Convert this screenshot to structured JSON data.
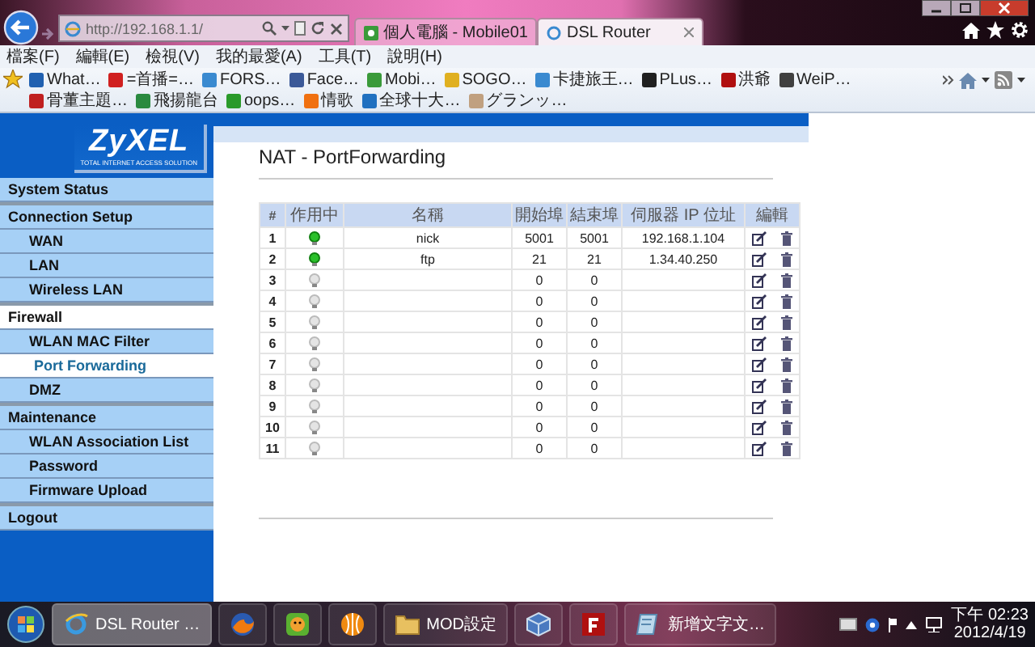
{
  "browser": {
    "address": "http://192.168.1.1/",
    "tabs": [
      {
        "label": "個人電腦 - Mobile01",
        "selected": false
      },
      {
        "label": "DSL Router",
        "selected": true
      }
    ],
    "menu": [
      "檔案(F)",
      "編輯(E)",
      "檢視(V)",
      "我的最愛(A)",
      "工具(T)",
      "說明(H)"
    ],
    "favorites": [
      {
        "label": "What…",
        "color": "#2060b0"
      },
      {
        "label": "=首播=…",
        "color": "#d02020"
      },
      {
        "label": "FORS…",
        "color": "#3a8ad0"
      },
      {
        "label": "Face…",
        "color": "#3b5998"
      },
      {
        "label": "Mobi…",
        "color": "#3a9a3a"
      },
      {
        "label": "SOGO…",
        "color": "#e0b020"
      },
      {
        "label": "卡捷旅王…",
        "color": "#3a8ad0"
      },
      {
        "label": "PLus…",
        "color": "#202020"
      },
      {
        "label": "洪爺",
        "color": "#b01010"
      },
      {
        "label": "WeiP…",
        "color": "#404040"
      },
      {
        "label": "骨董主題…",
        "color": "#c02020"
      },
      {
        "label": "飛揚龍台",
        "color": "#2a8a40"
      },
      {
        "label": "oops…",
        "color": "#2a9a2a"
      },
      {
        "label": "情歌",
        "color": "#f07010"
      },
      {
        "label": "全球十大…",
        "color": "#2070c0"
      },
      {
        "label": "グランッ…",
        "color": "#c0a080"
      }
    ]
  },
  "sidebar": {
    "logo": "ZyXEL",
    "tagline": "TOTAL INTERNET ACCESS SOLUTION",
    "items": [
      {
        "label": "System Status",
        "selected": false
      },
      {
        "label": "Connection Setup",
        "selected": false,
        "children": [
          {
            "label": "WAN",
            "selected": false
          },
          {
            "label": "LAN",
            "selected": false
          },
          {
            "label": "Wireless LAN",
            "selected": false
          }
        ]
      },
      {
        "label": "Firewall",
        "selected": true,
        "children": [
          {
            "label": "WLAN MAC Filter",
            "selected": false
          },
          {
            "label": "Port Forwarding",
            "selected": true
          },
          {
            "label": "DMZ",
            "selected": false
          }
        ]
      },
      {
        "label": "Maintenance",
        "selected": false,
        "children": [
          {
            "label": "WLAN Association List",
            "selected": false
          },
          {
            "label": "Password",
            "selected": false
          },
          {
            "label": "Firmware Upload",
            "selected": false
          }
        ]
      },
      {
        "label": "Logout",
        "selected": false
      }
    ]
  },
  "page": {
    "title": "NAT - PortForwarding",
    "table": {
      "columns": [
        "#",
        "作用中",
        "名稱",
        "開始埠",
        "結束埠",
        "伺服器 IP 位址",
        "編輯"
      ],
      "rows": [
        {
          "index": "1",
          "active": true,
          "name": "nick",
          "start": "5001",
          "end": "5001",
          "ip": "192.168.1.104"
        },
        {
          "index": "2",
          "active": true,
          "name": "ftp",
          "start": "21",
          "end": "21",
          "ip": "1.34.40.250"
        },
        {
          "index": "3",
          "active": false,
          "start": "0",
          "end": "0"
        },
        {
          "index": "4",
          "active": false,
          "start": "0",
          "end": "0"
        },
        {
          "index": "5",
          "active": false,
          "start": "0",
          "end": "0"
        },
        {
          "index": "6",
          "active": false,
          "start": "0",
          "end": "0"
        },
        {
          "index": "7",
          "active": false,
          "start": "0",
          "end": "0"
        },
        {
          "index": "8",
          "active": false,
          "start": "0",
          "end": "0"
        },
        {
          "index": "9",
          "active": false,
          "start": "0",
          "end": "0"
        },
        {
          "index": "10",
          "active": false,
          "start": "0",
          "end": "0"
        },
        {
          "index": "11",
          "active": false,
          "start": "0",
          "end": "0"
        }
      ]
    }
  },
  "taskbar": {
    "items": [
      {
        "kind": "browser",
        "label": "DSL Router …",
        "selected": true
      },
      {
        "kind": "firefox",
        "selected": false
      },
      {
        "kind": "chat",
        "selected": false
      },
      {
        "kind": "orb",
        "selected": false
      },
      {
        "kind": "folder",
        "label": "MOD設定",
        "selected": false
      },
      {
        "kind": "cube",
        "selected": false
      },
      {
        "kind": "filezilla",
        "selected": false
      },
      {
        "kind": "notepad",
        "label": "新增文字文…",
        "selected": false
      }
    ],
    "time": "下午 02:23",
    "date": "2012/4/19"
  }
}
